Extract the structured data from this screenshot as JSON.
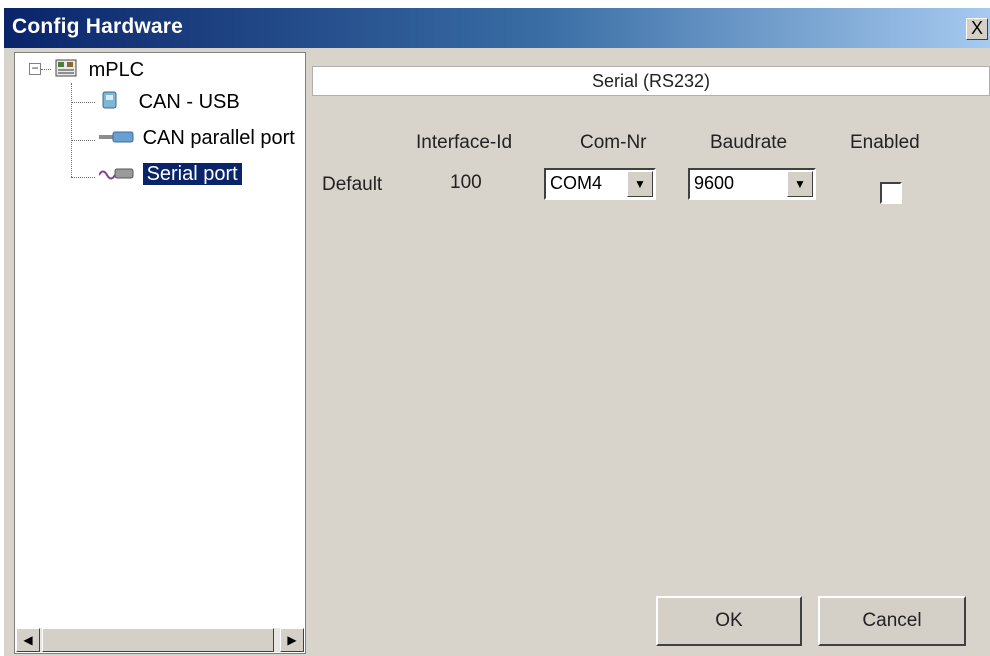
{
  "window": {
    "title": "Config Hardware",
    "close_glyph": "X"
  },
  "tree": {
    "root": {
      "label": "mPLC",
      "icon": "plc-icon",
      "expander": "−"
    },
    "children": [
      {
        "label": "CAN - USB",
        "icon": "usb-device-icon",
        "selected": false
      },
      {
        "label": "CAN parallel port",
        "icon": "parallel-port-icon",
        "selected": false
      },
      {
        "label": "Serial port",
        "icon": "serial-cable-icon",
        "selected": true
      }
    ],
    "scroll_left": "◀",
    "scroll_right": "▶"
  },
  "panel": {
    "header": "Serial (RS232)",
    "columns": {
      "interface_id": "Interface-Id",
      "com_nr": "Com-Nr",
      "baudrate": "Baudrate",
      "enabled": "Enabled"
    },
    "row": {
      "label": "Default",
      "interface_id": "100",
      "com_nr": "COM4",
      "baudrate": "9600",
      "enabled": false
    },
    "dropdown_glyph": "▼"
  },
  "buttons": {
    "ok": "OK",
    "cancel": "Cancel"
  },
  "colors": {
    "title_start": "#0a246a",
    "title_end": "#a6caf0",
    "selection": "#0a246a",
    "dialog_bg": "#d8d4cc"
  }
}
